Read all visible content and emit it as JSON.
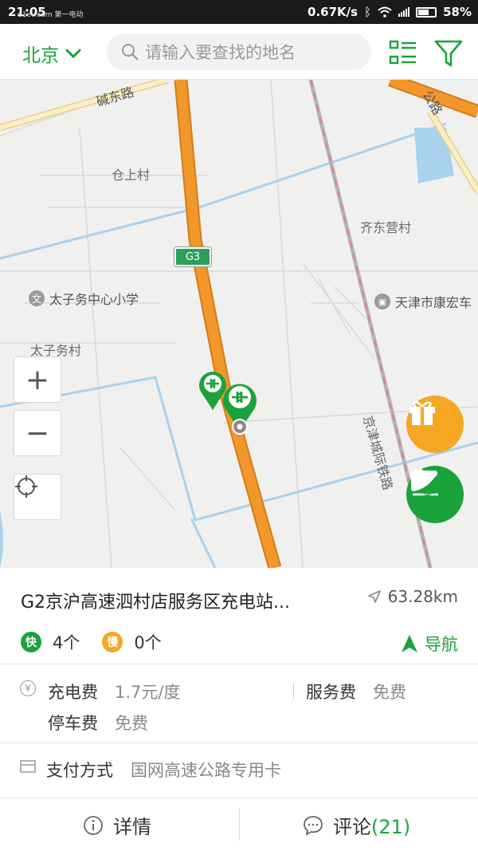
{
  "status_bar": {
    "time": "21:05",
    "watermark": "d1ev.com 第一电动",
    "speed": "0.67K/s",
    "battery": "58%"
  },
  "header": {
    "city": "北京",
    "search_placeholder": "请输入要查找的地名",
    "list_icon": "list-icon",
    "filter_icon": "filter-icon"
  },
  "map": {
    "labels": {
      "jiandong_road": "碱东路",
      "gongyuan_road": "公路",
      "cangshang_village": "仓上村",
      "qidongying_village": "齐东营村",
      "g3": "G3",
      "school": "太子务中心小学",
      "tianjin_kanghong": "天津市康宏车",
      "taiziwu_village": "太子务村",
      "railway": "京津城际铁路"
    },
    "zoom_in": "+",
    "zoom_out": "−",
    "locate_icon": "locate-icon",
    "gift_icon": "gift-icon",
    "signin_label": "签到"
  },
  "station": {
    "name": "G2京沪高速泗村店服务区充电站...",
    "distance": "63.28km",
    "fast_badge": "快",
    "fast_count": "4个",
    "slow_badge": "慢",
    "slow_count": "0个",
    "nav_label": "导航"
  },
  "fees": {
    "charge_label": "充电费",
    "charge_value": "1.7元/度",
    "service_label": "服务费",
    "service_value": "免费",
    "parking_label": "停车费",
    "parking_value": "免费"
  },
  "payment": {
    "label": "支付方式",
    "value": "国网高速公路专用卡"
  },
  "tabs": {
    "details": "详情",
    "comments": "评论",
    "comments_count": "(21)"
  },
  "colors": {
    "brand_green": "#1aa33a",
    "highway_orange": "#f2972a",
    "slow_orange": "#f5a623"
  }
}
